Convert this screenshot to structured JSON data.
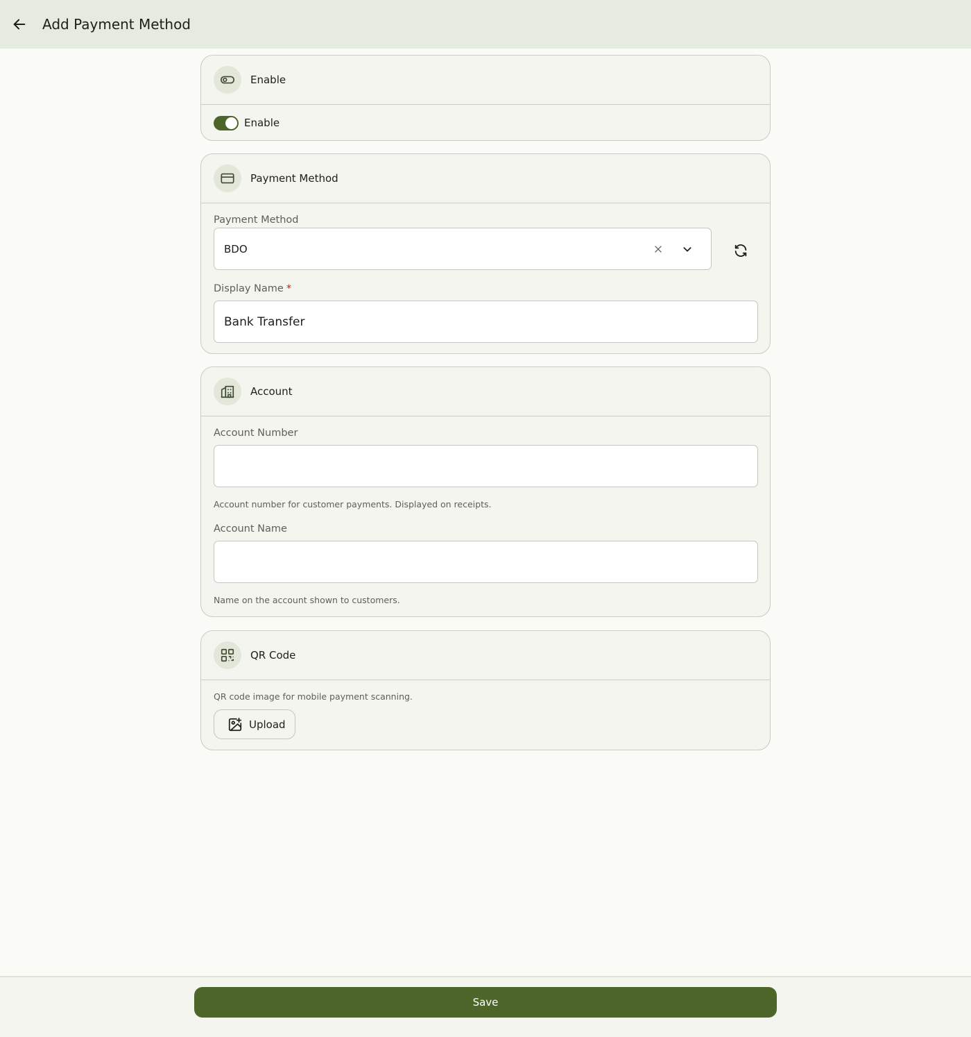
{
  "header": {
    "title": "Add Payment Method",
    "back_icon": "arrow-left-icon"
  },
  "enable_section": {
    "title": "Enable",
    "icon": "toggle-icon",
    "toggle_label": "Enable",
    "toggle_on": true
  },
  "payment_section": {
    "title": "Payment Method",
    "icon": "credit-card-icon",
    "method_label": "Payment Method",
    "method_value": "BDO",
    "display_name_label": "Display Name",
    "display_name_required": "*",
    "display_name_value": "Bank Transfer"
  },
  "account_section": {
    "title": "Account",
    "icon": "bank-building-icon",
    "number_label": "Account Number",
    "number_value": "",
    "number_help": "Account number for customer payments. Displayed on receipts.",
    "name_label": "Account Name",
    "name_value": "",
    "name_help": "Name on the account shown to customers."
  },
  "qr_section": {
    "title": "QR Code",
    "icon": "qr-code-icon",
    "help": "QR code image for mobile payment scanning.",
    "upload_label": "Upload"
  },
  "footer": {
    "save_label": "Save"
  },
  "colors": {
    "accent": "#4b6628",
    "header_bg": "#e5ebdf",
    "required": "#b3261e"
  }
}
